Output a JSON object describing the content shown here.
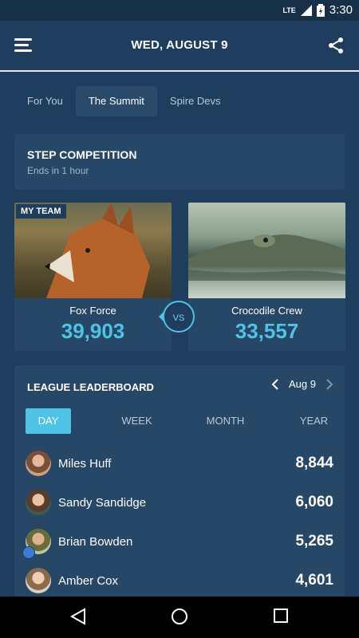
{
  "status": {
    "network": "LTE",
    "time": "3:30"
  },
  "appbar": {
    "title": "WED, AUGUST 9"
  },
  "tabs": [
    {
      "label": "For You"
    },
    {
      "label": "The Summit"
    },
    {
      "label": "Spire Devs"
    }
  ],
  "competition": {
    "title": "STEP COMPETITION",
    "subtitle": "Ends in 1 hour"
  },
  "teams": {
    "badge": "MY TEAM",
    "left": {
      "name": "Fox Force",
      "score": "39,903"
    },
    "right": {
      "name": "Crocodile Crew",
      "score": "33,557"
    },
    "vs": "VS"
  },
  "leaderboard": {
    "title": "LEAGUE LEADERBOARD",
    "date": "Aug 9",
    "periods": [
      "DAY",
      "WEEK",
      "MONTH",
      "YEAR"
    ],
    "rows": [
      {
        "name": "Miles Huff",
        "value": "8,844"
      },
      {
        "name": "Sandy Sandidge",
        "value": "6,060"
      },
      {
        "name": "Brian Bowden",
        "value": "5,265"
      },
      {
        "name": "Amber Cox",
        "value": "4,601"
      }
    ]
  }
}
